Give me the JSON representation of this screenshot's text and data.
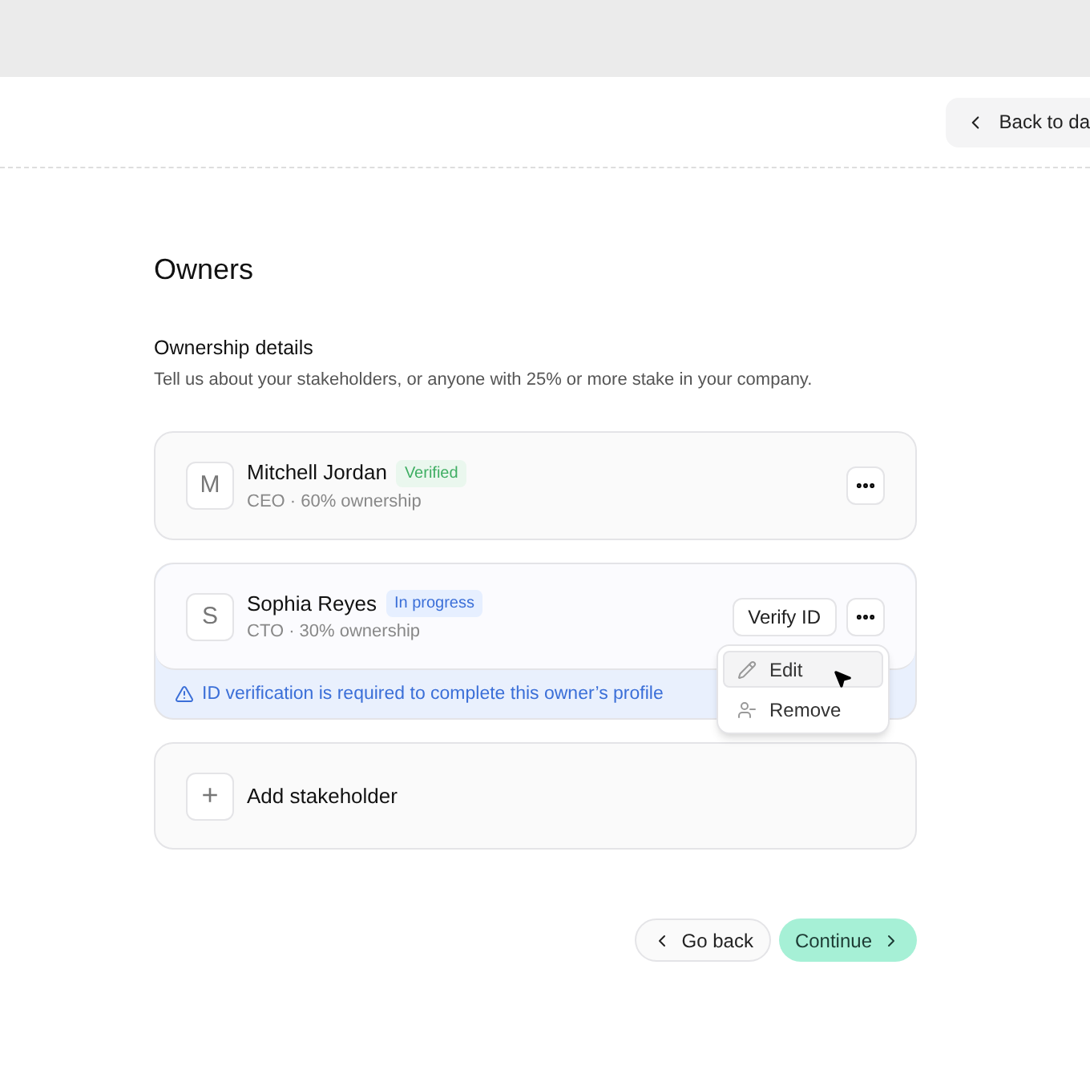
{
  "header": {
    "back_button": "Back to da"
  },
  "page": {
    "title": "Owners",
    "section_title": "Ownership details",
    "section_description": "Tell us about your stakeholders, or anyone with 25% or more stake in your company."
  },
  "owners": [
    {
      "initial": "M",
      "name": "Mitchell Jordan",
      "status": {
        "kind": "verified",
        "label": "Verified"
      },
      "details": "CEO · 60% ownership",
      "menu_open": false
    },
    {
      "initial": "S",
      "name": "Sophia Reyes",
      "status": {
        "kind": "in_progress",
        "label": "In progress"
      },
      "details": "CTO · 30% ownership",
      "action": "Verify ID",
      "menu_open": true,
      "alert": "ID verification is required to complete this owner’s profile"
    }
  ],
  "menu": [
    {
      "kind": "edit",
      "label": "Edit",
      "selected": true
    },
    {
      "kind": "remove",
      "label": "Remove",
      "selected": false
    }
  ],
  "add_stakeholder": {
    "icon": "+",
    "label": "Add stakeholder"
  },
  "footer": {
    "back": "Go back",
    "continue": "Continue"
  }
}
